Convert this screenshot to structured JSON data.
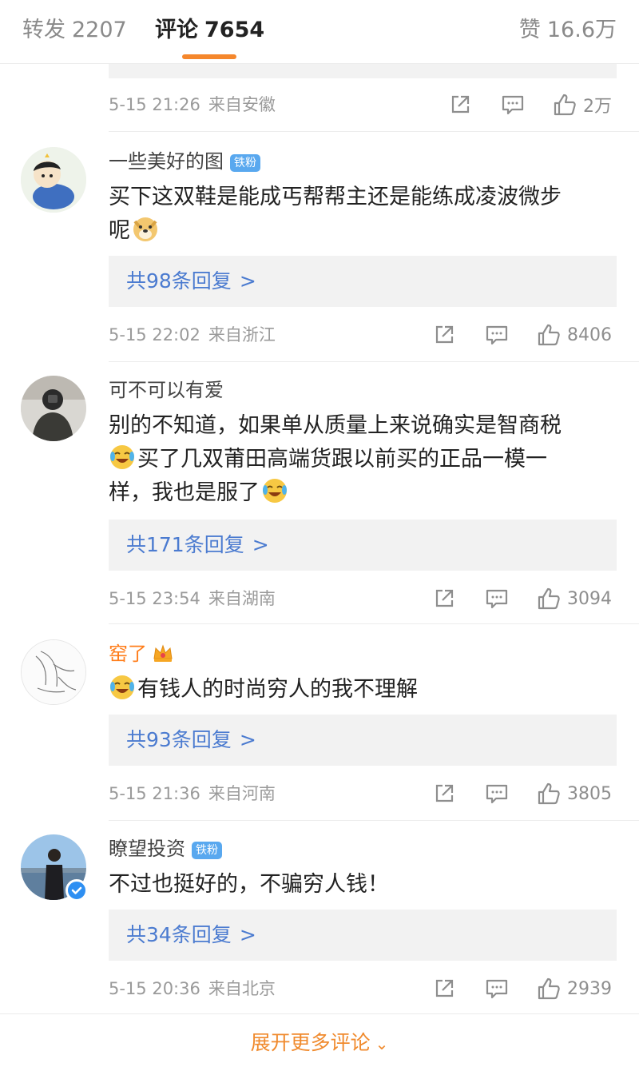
{
  "tabs": {
    "repost_label": "转发",
    "repost_count": "2207",
    "comments_label": "评论",
    "comments_count": "7654",
    "likes_label": "赞",
    "likes_count": "16.6万"
  },
  "top_meta": {
    "time": "5-15 21:26",
    "location": "来自安徽",
    "likes": "2万"
  },
  "comments": [
    {
      "username": "一些美好的图",
      "badge": "铁粉",
      "text_line1": "买下这双鞋是能成丐帮帮主还是能练成凌波微步",
      "text_line2": "呢",
      "reply_count": "共98条回复",
      "time": "5-15 22:02",
      "location": "来自浙江",
      "likes": "8406"
    },
    {
      "username": "可不可以有爱",
      "text_line1": "别的不知道，如果单从质量上来说确实是智商税",
      "text_line2": "买了几双莆田高端货跟以前买的正品一模一",
      "text_line3": "样，我也是服了",
      "reply_count": "共171条回复",
      "time": "5-15 23:54",
      "location": "来自湖南",
      "likes": "3094"
    },
    {
      "username": "窑了",
      "text_line1": "有钱人的时尚穷人的我不理解",
      "reply_count": "共93条回复",
      "time": "5-15 21:36",
      "location": "来自河南",
      "likes": "3805"
    },
    {
      "username": "瞭望投资",
      "badge": "铁粉",
      "text_line1": "不过也挺好的，不骗穷人钱！",
      "reply_count": "共34条回复",
      "time": "5-15 20:36",
      "location": "来自北京",
      "likes": "2939"
    }
  ],
  "reply_chevron": ">",
  "footer": {
    "label": "展开更多评论",
    "icon": "chevron-down-icon"
  },
  "colors": {
    "accent": "#f5872c",
    "link": "#4b7bd0",
    "fan_badge": "#59a8ef",
    "verified": "#2e8ff2"
  }
}
